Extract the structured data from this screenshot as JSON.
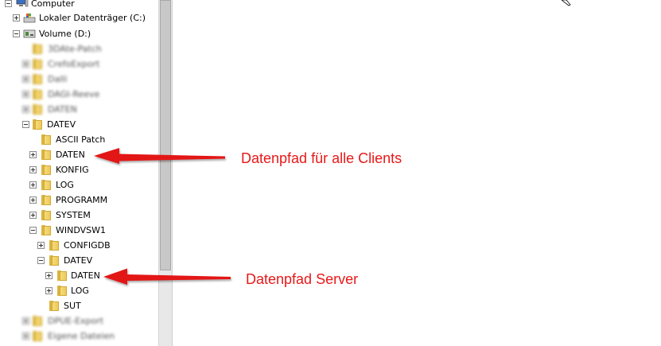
{
  "tree": {
    "computer": "Computer",
    "drive_c": "Lokaler Datenträger (C:)",
    "drive_d": "Volume (D:)",
    "blurred": [
      "3DAte-Patch",
      "CrefoExport",
      "Dalli",
      "DAGI-Reeve",
      "DATEN"
    ],
    "datev": "DATEV",
    "datev_children": [
      "ASCII Patch",
      "DATEN",
      "KONFIG",
      "LOG",
      "PROGRAMM",
      "SYSTEM",
      "WINDVSW1"
    ],
    "windvsw1_children": [
      "CONFIGDB",
      "DATEV"
    ],
    "datev2_children": [
      "DATEN",
      "LOG"
    ],
    "sut": "SUT",
    "blurred_bottom": [
      "DPUE-Export",
      "Eigene Dateien"
    ]
  },
  "annotations": {
    "clients": "Datenpfad für alle Clients",
    "server": "Datenpfad Server",
    "arrow_color": "#e31616"
  }
}
